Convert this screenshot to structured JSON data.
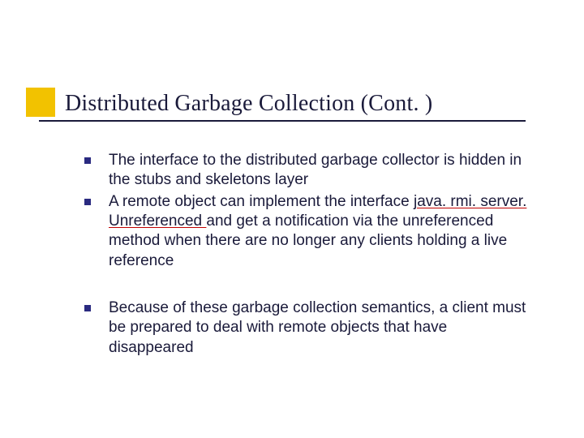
{
  "slide": {
    "title": "Distributed Garbage Collection (Cont. )",
    "bullets_group1": [
      {
        "text": "The interface to the distributed garbage collector is hidden in the stubs and skeletons layer"
      },
      {
        "prefix": "A remote object can implement the interface ",
        "underlined": "java. rmi. server. Unreferenced ",
        "suffix": "and get a notification via the unreferenced method when there are no longer any clients holding a live reference"
      }
    ],
    "bullets_group2": [
      {
        "text": "Because of these garbage collection semantics, a client must be prepared to deal with remote objects that have disappeared"
      }
    ]
  }
}
